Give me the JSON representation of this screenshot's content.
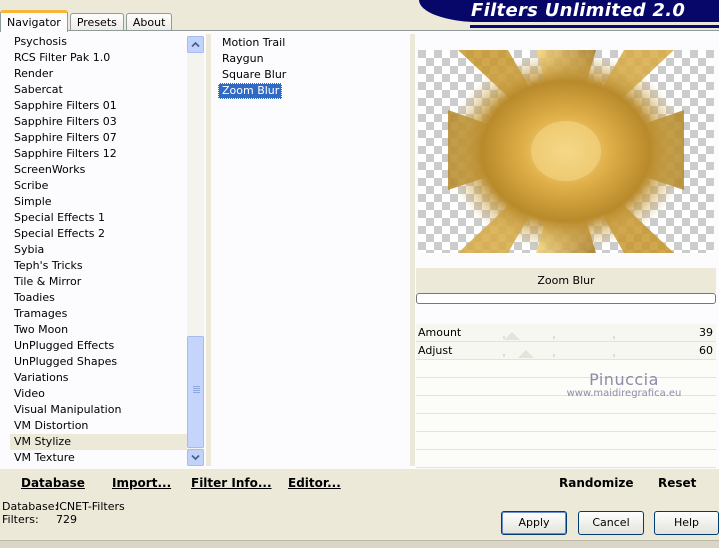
{
  "tabs": [
    {
      "label": "Navigator",
      "active": true
    },
    {
      "label": "Presets",
      "active": false
    },
    {
      "label": "About",
      "active": false
    }
  ],
  "banner_title": "Filters Unlimited 2.0",
  "categories": [
    "Psychosis",
    "RCS Filter Pak 1.0",
    "Render",
    "Sabercat",
    "Sapphire Filters 01",
    "Sapphire Filters 03",
    "Sapphire Filters 07",
    "Sapphire Filters 12",
    "ScreenWorks",
    "Scribe",
    "Simple",
    "Special Effects 1",
    "Special Effects 2",
    "Sybia",
    "Teph's Tricks",
    "Tile & Mirror",
    "Toadies",
    "Tramages",
    "Two Moon",
    "UnPlugged Effects",
    "UnPlugged Shapes",
    "Variations",
    "Video",
    "Visual Manipulation",
    "VM Distortion",
    "VM Stylize",
    "VM Texture"
  ],
  "selected_category": "VM Stylize",
  "filters": [
    "Motion Trail",
    "Raygun",
    "Square Blur",
    "Zoom Blur"
  ],
  "selected_filter": "Zoom Blur",
  "filter_name_display": "Zoom Blur",
  "params": [
    {
      "label": "Amount",
      "value": "39",
      "level": 39
    },
    {
      "label": "Adjust",
      "value": "60",
      "level": 60
    }
  ],
  "watermark": {
    "line1": "Pinuccia",
    "line2": "www.maidiregrafica.eu"
  },
  "bottom_buttons": {
    "database": "Database",
    "import": "Import...",
    "filter_info": "Filter Info...",
    "editor": "Editor...",
    "randomize": "Randomize",
    "reset": "Reset"
  },
  "status": {
    "database_label": "Database:",
    "database_value": "ICNET-Filters",
    "filters_label": "Filters:",
    "filters_value": "729"
  },
  "dialog_buttons": {
    "apply": "Apply",
    "cancel": "Cancel",
    "help": "Help"
  },
  "colors": {
    "selection": "#316ac5",
    "banner": "#07076a",
    "tab_accent": "#f7b63a"
  },
  "icons": {
    "scroll_up": "chevron-up-icon",
    "scroll_down": "chevron-down-icon"
  }
}
